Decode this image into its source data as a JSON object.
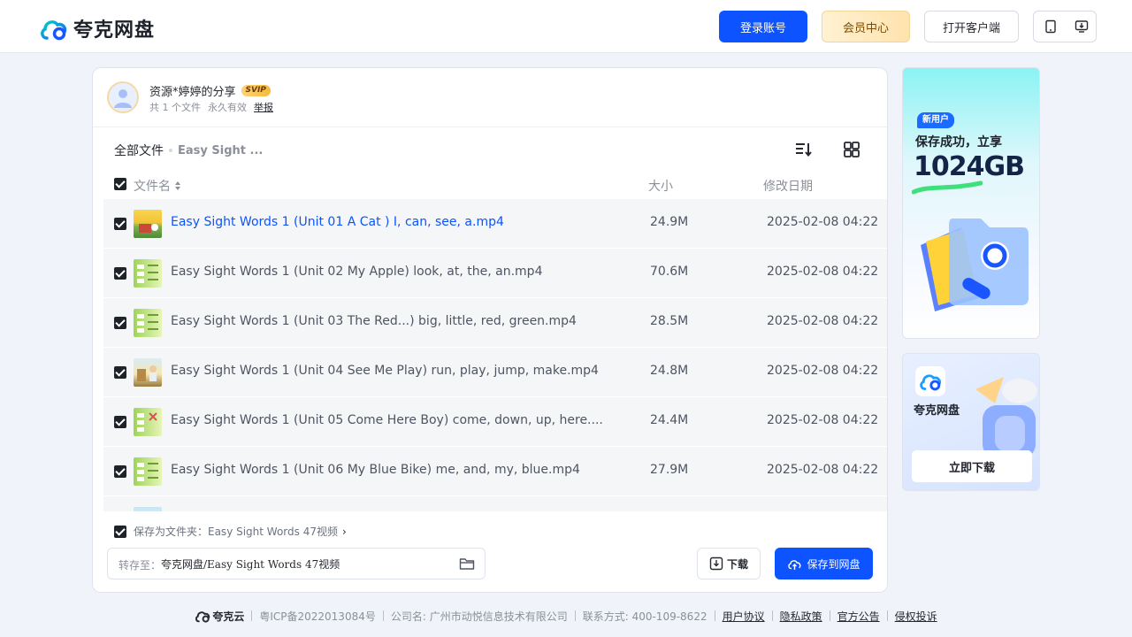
{
  "header": {
    "logo_text": "夸克网盘",
    "login_label": "登录账号",
    "vip_label": "会员中心",
    "client_label": "打开客户端"
  },
  "share": {
    "title": "资源*婷婷的分享",
    "badge": "SVIP",
    "file_count": "共 1 个文件",
    "validity": "永久有效",
    "report": "举报"
  },
  "breadcrumb": {
    "root": "全部文件",
    "current": "Easy Sight ..."
  },
  "table": {
    "col_name": "文件名",
    "col_size": "大小",
    "col_date": "修改日期",
    "rows": [
      {
        "name": "Easy Sight Words 1 (Unit 01 A Cat ) I, can, see, a.mp4",
        "size": "24.9M",
        "date": "2025-02-08 04:22"
      },
      {
        "name": "Easy Sight Words 1 (Unit 02 My Apple) look, at, the, an.mp4",
        "size": "70.6M",
        "date": "2025-02-08 04:22"
      },
      {
        "name": "Easy Sight Words 1 (Unit 03 The Red...) big, little, red, green.mp4",
        "size": "28.5M",
        "date": "2025-02-08 04:22"
      },
      {
        "name": "Easy Sight Words 1 (Unit 04 See Me Play) run, play, jump, make.mp4",
        "size": "24.8M",
        "date": "2025-02-08 04:22"
      },
      {
        "name": "Easy Sight Words 1 (Unit 05 Come Here Boy) come, down, up, here....",
        "size": "24.4M",
        "date": "2025-02-08 04:22"
      },
      {
        "name": "Easy Sight Words 1 (Unit 06 My Blue Bike) me, and, my, blue.mp4",
        "size": "27.9M",
        "date": "2025-02-08 04:22"
      }
    ]
  },
  "bottom": {
    "save_folder": "保存为文件夹：Easy Sight Words 47视频",
    "dest_label": "转存至：",
    "dest_path": "夸克网盘/Easy Sight Words 47视频",
    "download_label": "下载",
    "save_label": "保存到网盘"
  },
  "ad1": {
    "tag": "新用户",
    "line1": "保存成功，立享",
    "big": "1024GB"
  },
  "ad2": {
    "name": "夸克网盘",
    "button": "立即下载"
  },
  "footer": {
    "brand": "夸克云",
    "icp": "粤ICP备2022013084号",
    "company": "公司名: 广州市动悦信息技术有限公司",
    "contact": "联系方式: 400-109-8622",
    "links": [
      "用户协议",
      "隐私政策",
      "官方公告",
      "侵权投诉"
    ]
  },
  "colors": {
    "brand_blue": "#0d53ff",
    "page_bg": "#f0f3fa",
    "row_bg": "#f5f6f7"
  },
  "icons": [
    "quark-logo-icon",
    "tablet-icon",
    "monitor-download-icon",
    "sort-icon",
    "grid-view-icon",
    "folder-icon",
    "download-icon",
    "cloud-upload-icon"
  ]
}
